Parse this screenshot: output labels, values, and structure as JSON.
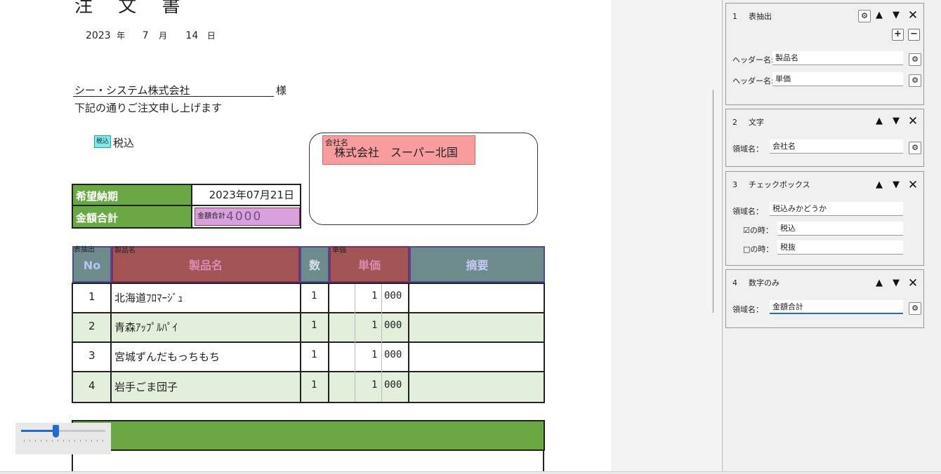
{
  "document": {
    "title": "注 文 書",
    "date": {
      "year": "2023",
      "year_unit": "年",
      "month": "7",
      "month_unit": "月",
      "day": "14",
      "day_unit": "日"
    },
    "customer": "シー・システム株式会社",
    "honorific": "様",
    "message": "下記の通りご注文申し上げます",
    "tax_tag": "税込",
    "tax_label": "税込",
    "company_tag": "会社名",
    "company_value": "株式会社　スーパー北国",
    "delivery_label": "希望納期",
    "delivery_value": "2023年07月21日",
    "total_label": "金額合計",
    "total_tag": "金額合計",
    "total_value": "4000",
    "products": {
      "tags": {
        "no": "表抽出",
        "name": "製品名",
        "price": "単価"
      },
      "headers": [
        "No",
        "製品名",
        "数",
        "単価",
        "摘要"
      ],
      "rows": [
        {
          "no": "1",
          "name": "北海道ﾌﾛﾏｰｼﾞｭ",
          "qty": "1",
          "price_a": "1",
          "price_b": "000"
        },
        {
          "no": "2",
          "name": "青森ｱｯﾌﾟﾙﾊﾟｲ",
          "qty": "1",
          "price_a": "1",
          "price_b": "000"
        },
        {
          "no": "3",
          "name": "宮城ずんだもっちもち",
          "qty": "1",
          "price_a": "1",
          "price_b": "000"
        },
        {
          "no": "4",
          "name": "岩手ごま団子",
          "qty": "1",
          "price_a": "1",
          "price_b": "000"
        }
      ]
    },
    "zoom_slider_level": 0.4
  },
  "panel": {
    "cards": [
      {
        "num": "1",
        "title": "表抽出",
        "fields": [
          {
            "label": "ヘッダー名:",
            "value": "製品名"
          },
          {
            "label": "ヘッダー名:",
            "value": "単価"
          }
        ]
      },
      {
        "num": "2",
        "title": "文字",
        "fields": [
          {
            "label": "領域名：",
            "value": "会社名"
          }
        ]
      },
      {
        "num": "3",
        "title": "チェックボックス",
        "fields": [
          {
            "label": "領域名：",
            "value": "税込みかどうか"
          },
          {
            "label": "☑の時：",
            "value": "税込"
          },
          {
            "label": "□の時：",
            "value": "税抜"
          }
        ]
      },
      {
        "num": "4",
        "title": "数字のみ",
        "fields": [
          {
            "label": "領域名：",
            "value": "金額合計"
          }
        ]
      }
    ]
  },
  "colors": {
    "green": "#6aa843",
    "light_green": "#e2efda",
    "slate": "#6e8b8b",
    "maroon": "#a35555",
    "pink": "#f89c9e",
    "purple": "#d6a1dd",
    "accent": "#1f6bd1"
  }
}
